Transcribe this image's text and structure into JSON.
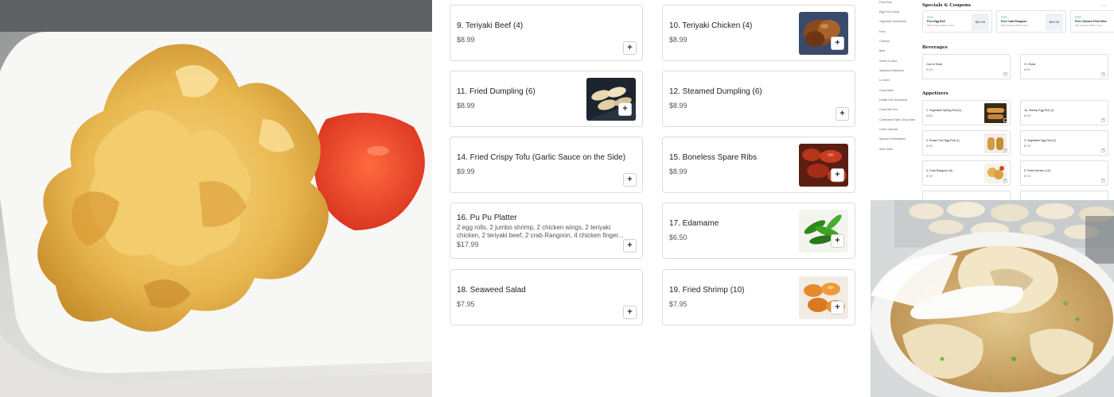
{
  "menu": {
    "items": [
      {
        "name": "9. Teriyaki Beef (4)",
        "price": "$8.99",
        "add_label": "+"
      },
      {
        "name": "10. Teriyaki Chicken (4)",
        "price": "$8.99",
        "add_label": "+",
        "image": "teriyaki-chicken-photo"
      },
      {
        "name": "11. Fried Dumpling (6)",
        "price": "$8.99",
        "add_label": "+",
        "image": "fried-dumpling-photo"
      },
      {
        "name": "12. Steamed Dumpling (6)",
        "price": "$8.99",
        "add_label": "+"
      },
      {
        "name": "14. Fried Crispy Tofu (Garlic Sauce on the Side)",
        "price": "$9.99",
        "add_label": "+"
      },
      {
        "name": "15. Boneless Spare Ribs",
        "price": "$8.99",
        "add_label": "+",
        "image": "spare-ribs-photo"
      },
      {
        "name": "16. Pu Pu Platter",
        "description": "2 egg rolls, 2 jumbo shrimp, 2 chicken wings, 2 teriyaki chicken, 2 teriyaki beef, 2 crab Rangoon, 4 chicken finger...",
        "price": "$17.99",
        "add_label": "+"
      },
      {
        "name": "17. Edamame",
        "price": "$6.50",
        "add_label": "+",
        "image": "edamame-photo"
      },
      {
        "name": "18. Seaweed Salad",
        "price": "$7.95",
        "add_label": "+"
      },
      {
        "name": "19. Fried Shrimp (10)",
        "price": "$7.95",
        "add_label": "+",
        "image": "fried-shrimp-photo"
      }
    ]
  },
  "mini_screenshot": {
    "sidebar": [
      "Fried Rice",
      "Egg Foo Young",
      "Vegetable Selections",
      "Pork",
      "Chicken",
      "Beef",
      "Sweet & Sour",
      "Seafood Selections",
      "Lo Mein",
      "Chow Mein",
      "Health Diet Selections",
      "Chow Mei Fun",
      "Cantonese Style Chow Mein",
      "Chef's Special",
      "Special Combination",
      "Side Order"
    ],
    "close_label": "× ×",
    "specials_heading": "Specials & Coupons",
    "coupons": [
      {
        "tag": "FREE",
        "title": "Free Egg Roll",
        "subtitle": "With purchase of $20 or more",
        "amount": "$20.00"
      },
      {
        "tag": "FREE",
        "title": "Free Crab Rangoon",
        "subtitle": "With purchase of $35 or more",
        "amount": "$20.00"
      },
      {
        "tag": "FREE",
        "title": "Free Chicken Fried Rice",
        "subtitle": "With purchase of $50 or more",
        "amount": ""
      }
    ],
    "beverages_heading": "Beverages",
    "beverages": [
      {
        "name": "Can of Soda",
        "price": "$1.59"
      },
      {
        "name": "2 L Soda",
        "price": "$3.99"
      }
    ],
    "appetizers_heading": "Appetizers",
    "appetizers": [
      {
        "name": "1. Vegetable Spring Roll (2)",
        "price": "$3.95"
      },
      {
        "name": "1a. Shrimp Egg Roll (1)",
        "price": "$1.99"
      },
      {
        "name": "2. Roast Pork Egg Roll (1)",
        "price": "$1.99"
      },
      {
        "name": "3. Vegetable Egg Roll (1)",
        "price": "$1.99"
      },
      {
        "name": "4. Crab Rangoon (8)",
        "price": "$7.50"
      },
      {
        "name": "5. Fried Wonton (10)",
        "price": "$7.50"
      }
    ]
  },
  "photos": {
    "left": "fried-wontons-with-sweet-sour-sauce",
    "bottom_right": "wonton-soup-bowl"
  },
  "colors": {
    "card_border": "#dcdcdc",
    "text": "#1f1f1f",
    "price": "#555555",
    "sauce": "#e8442c",
    "wonton": "#e9b850"
  }
}
